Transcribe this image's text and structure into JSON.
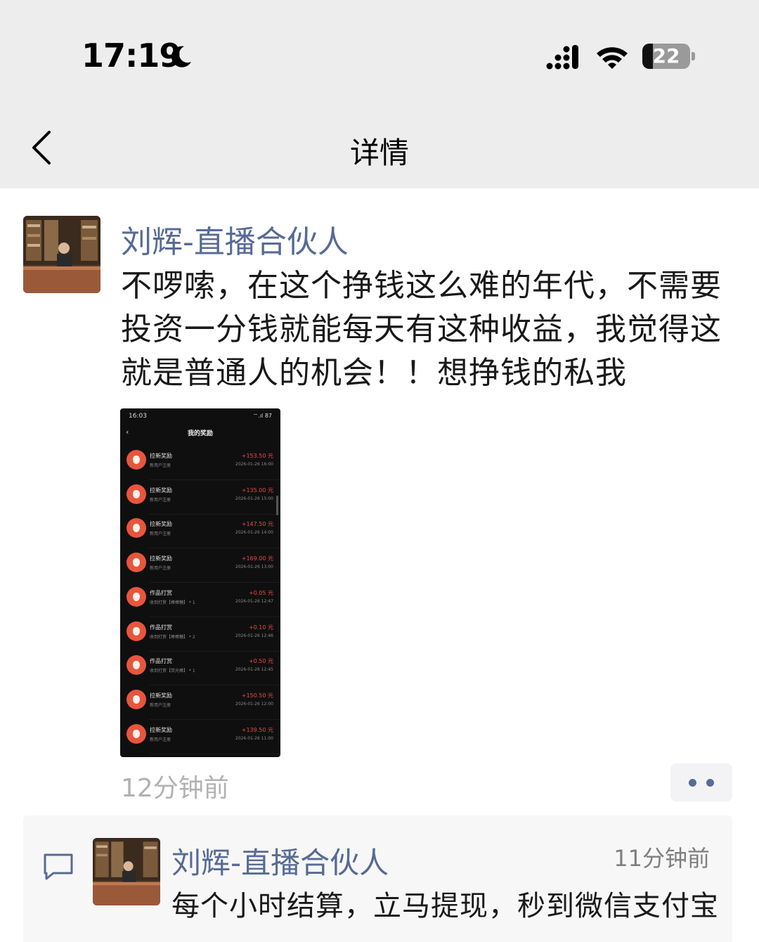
{
  "status_bar": {
    "time": "17:19",
    "battery_level": "22",
    "icons": [
      "moon-icon",
      "cellular-signal-icon",
      "wifi-icon",
      "battery-icon"
    ]
  },
  "nav": {
    "title": "详情",
    "back_icon": "chevron-left-icon"
  },
  "post": {
    "author": "刘辉-直播合伙人",
    "text": "不啰嗦，在这个挣钱这么难的年代，不需要投资一分钱就能每天有这种收益，我觉得这就是普通人的机会！！想挣钱的私我",
    "time": "12分钟前",
    "more_icon": "more-dots-icon"
  },
  "screenshot": {
    "time": "16:03",
    "status_icons": "⌔.ıl 87",
    "back": "‹",
    "title": "我的奖励",
    "rows": [
      {
        "title": "拉新奖励",
        "sub": "新用户注册",
        "amount": "+153.50 元",
        "date": "2026-01-26 16:00"
      },
      {
        "title": "拉新奖励",
        "sub": "新用户注册",
        "amount": "+135.00 元",
        "date": "2026-01-26 15:00"
      },
      {
        "title": "拉新奖励",
        "sub": "新用户注册",
        "amount": "+147.50 元",
        "date": "2026-01-26 14:00"
      },
      {
        "title": "拉新奖励",
        "sub": "新用户注册",
        "amount": "+169.00 元",
        "date": "2026-01-26 13:00"
      },
      {
        "title": "作品打赏",
        "sub": "收到打赏【棒棒糖】 * 1",
        "amount": "+0.05 元",
        "date": "2026-01-26 12:47"
      },
      {
        "title": "作品打赏",
        "sub": "收到打赏【棒棒糖】 * 2",
        "amount": "+0.10 元",
        "date": "2026-01-26 12:46"
      },
      {
        "title": "作品打赏",
        "sub": "收到打赏【荧光棒】 * 1",
        "amount": "+0.50 元",
        "date": "2026-01-26 12:45"
      },
      {
        "title": "拉新奖励",
        "sub": "新用户注册",
        "amount": "+150.50 元",
        "date": "2026-01-26 12:00"
      },
      {
        "title": "拉新奖励",
        "sub": "新用户注册",
        "amount": "+139.50 元",
        "date": "2026-01-26 11:00"
      }
    ]
  },
  "comment": {
    "icon": "comment-bubble-icon",
    "author": "刘辉-直播合伙人",
    "time": "11分钟前",
    "text": "每个小时结算，立马提现，秒到微信支付宝"
  },
  "colors": {
    "link_blue": "#576b95",
    "bar_gray": "#ededed",
    "reward_red": "#f04a4a"
  }
}
